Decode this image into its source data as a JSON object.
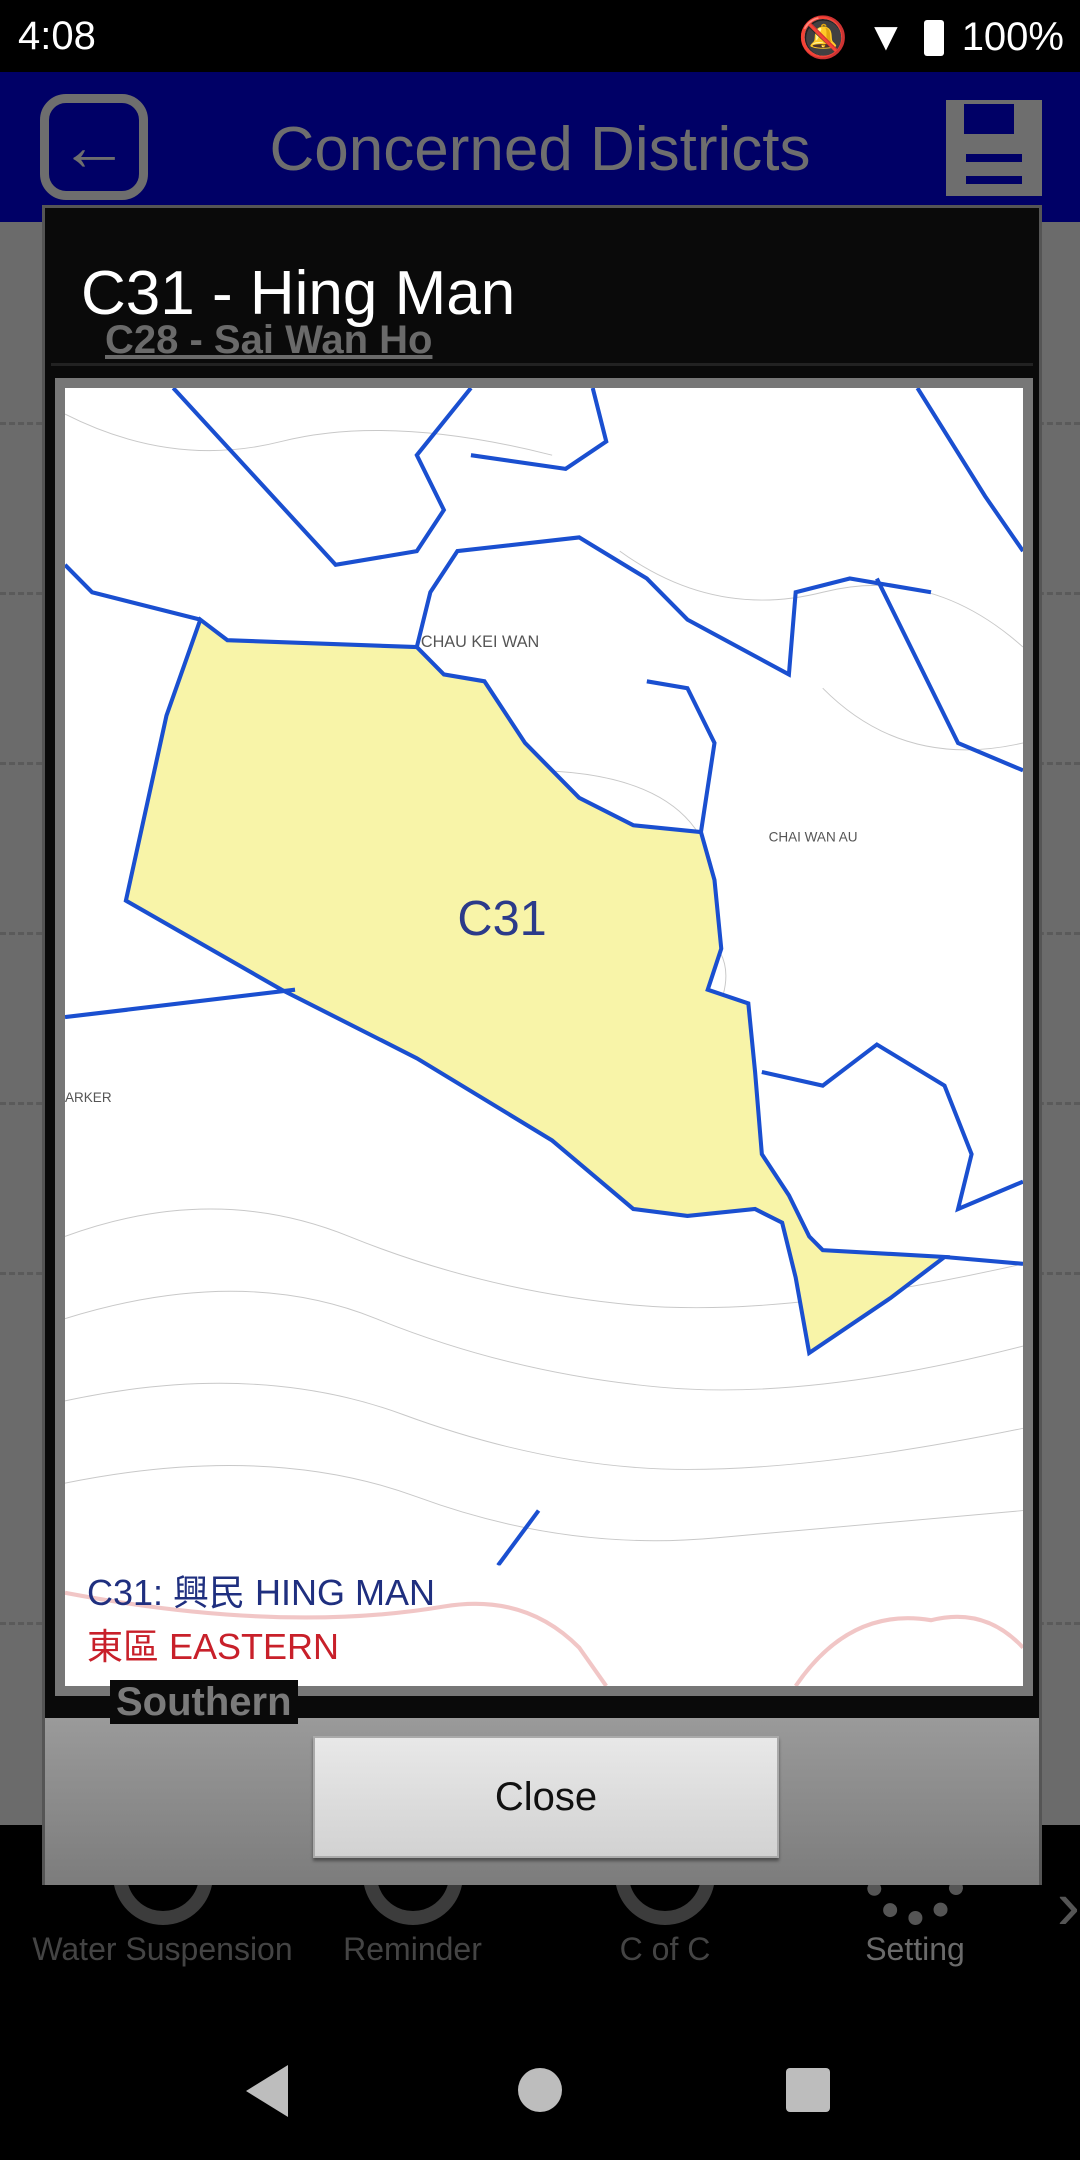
{
  "status_bar": {
    "time": "4:08",
    "battery": "100%",
    "icons": [
      "bell-off-icon",
      "wifi-icon",
      "battery-icon"
    ]
  },
  "header": {
    "title": "Concerned Districts",
    "back_icon": "back-arrow-icon",
    "save_icon": "floppy-save-icon"
  },
  "background_list": {
    "items": [
      "C28 -  Sai Wan Ho",
      "Southern"
    ]
  },
  "bottom_nav": {
    "items": [
      {
        "label": "Water Suspension",
        "icon": "water-tap-icon"
      },
      {
        "label": "Reminder",
        "icon": "alarm-clock-icon"
      },
      {
        "label": "C of C",
        "icon": "people-icon"
      },
      {
        "label": "Setting",
        "icon": "gear-icon",
        "active": true
      }
    ],
    "more_icon": "chevron-right-icon"
  },
  "dialog": {
    "title": "C31 -  Hing Man",
    "map": {
      "district_label": "C31",
      "place_labels": [
        "CHAU KEI WAN",
        "CHAI WAN AU",
        "ARKER"
      ],
      "legend_line1": "C31: 興民 HING MAN",
      "legend_line2": "東區 EASTERN",
      "highlight_color": "#f8f4a8",
      "boundary_color": "#1a4fd0"
    },
    "close_label": "Close"
  }
}
